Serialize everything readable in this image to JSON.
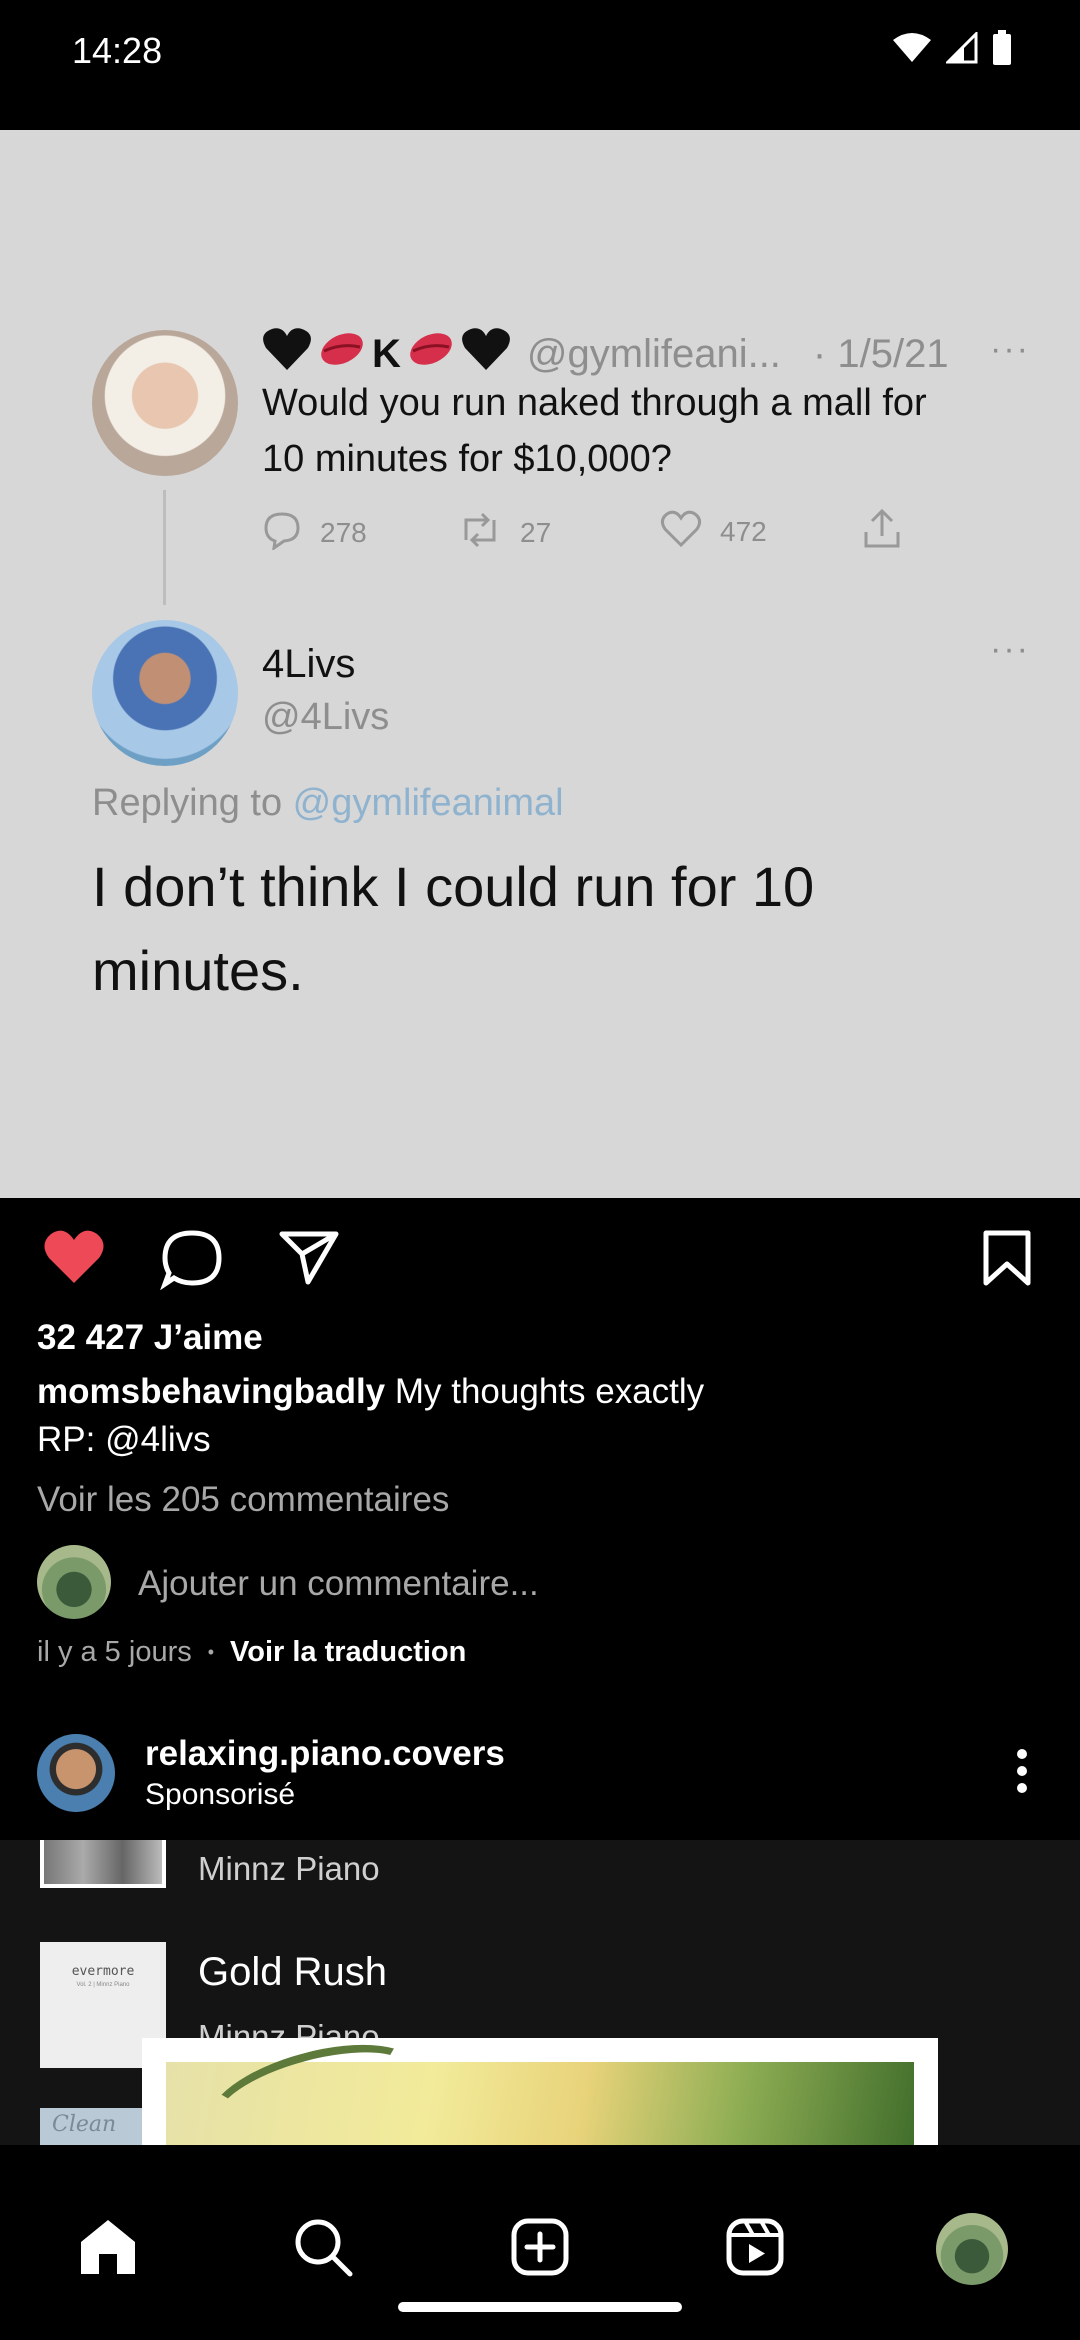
{
  "status_bar": {
    "time": "14:28"
  },
  "tweet": {
    "author_handle_line": "@gymlifeani...",
    "date": "· 1/5/21",
    "author_name_marker": "K",
    "text_line1": "Would you run naked through a mall for",
    "text_line2": "10 minutes for $10,000?",
    "reply_count": "278",
    "retweet_count": "27",
    "like_count": "472",
    "reply_name": "4Livs",
    "reply_handle": "@4Livs",
    "replying_prefix": "Replying to ",
    "replying_handle": "@gymlifeanimal",
    "reply_text_line1": "I don’t think I could run for 10",
    "reply_text_line2": "minutes."
  },
  "post": {
    "likes": "32 427 J’aime",
    "caption_user": "momsbehavingbadly",
    "caption_text": " My thoughts exactly",
    "caption_line2": "RP: @4livs",
    "view_comments": "Voir les 205 commentaires",
    "add_comment_placeholder": "Ajouter un commentaire...",
    "time_ago": "il y a 5 jours",
    "separator": "•",
    "translate": "Voir la traduction"
  },
  "sponsored": {
    "username": "relaxing.piano.covers",
    "label": "Sponsorisé",
    "track1_artist": "Minnz Piano",
    "track2_title": "Gold Rush",
    "track2_artist": "Minnz Piano",
    "album_word": "evermore",
    "album_sub": "Vol. 2 | Minnz Piano",
    "album3_word": "Clean"
  },
  "colors": {
    "like_red": "#ed4956",
    "gray_text": "#a8a8a8",
    "tweet_bg": "#d7d7d7",
    "tweet_link": "#8fb3cf"
  },
  "icons": [
    "wifi-icon",
    "signal-icon",
    "battery-icon",
    "heart-icon",
    "comment-icon",
    "share-icon",
    "bookmark-icon",
    "more-icon",
    "home-icon",
    "search-icon",
    "create-icon",
    "reels-icon"
  ]
}
